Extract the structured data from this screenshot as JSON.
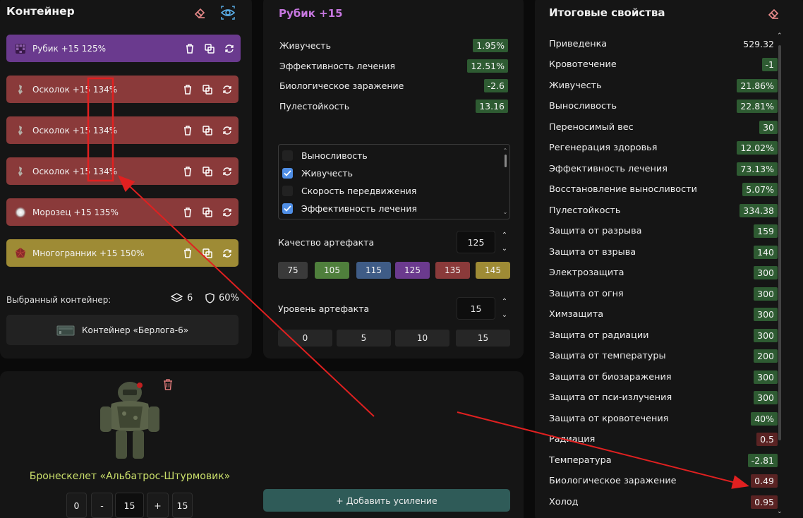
{
  "container_panel": {
    "title": "Контейнер",
    "items": [
      {
        "name": "Рубик +15 125%",
        "color": "#6a3a8e",
        "art": "rubik"
      },
      {
        "name": "Осколок +15 134%",
        "color": "#8a3a3a",
        "art": "shard"
      },
      {
        "name": "Осколок +15 134%",
        "color": "#8a3a3a",
        "art": "shard"
      },
      {
        "name": "Осколок +15 134%",
        "color": "#8a3a3a",
        "art": "shard"
      },
      {
        "name": "Морозец +15 135%",
        "color": "#8a3a3a",
        "art": "frost"
      },
      {
        "name": "Многогранник +15 150%",
        "color": "#9e8b35",
        "art": "polyhedron"
      }
    ],
    "selected_label": "Выбранный контейнер:",
    "slots_count": "6",
    "protection": "60%",
    "container_name": "Контейнер «Берлога-6»"
  },
  "artifact_panel": {
    "title": "Рубик +15",
    "stats": [
      {
        "label": "Живучесть",
        "value": "1.95%",
        "tone": "green"
      },
      {
        "label": "Эффективность лечения",
        "value": "12.51%",
        "tone": "green"
      },
      {
        "label": "Биологическое заражение",
        "value": "-2.6",
        "tone": "green"
      },
      {
        "label": "Пулестойкость",
        "value": "13.16",
        "tone": "green"
      }
    ],
    "filters": [
      {
        "label": "Выносливость",
        "checked": false
      },
      {
        "label": "Живучесть",
        "checked": true
      },
      {
        "label": "Скорость передвижения",
        "checked": false
      },
      {
        "label": "Эффективность лечения",
        "checked": true
      }
    ],
    "quality_label": "Качество артефакта",
    "quality_value": "125",
    "quality_options": [
      {
        "label": "75",
        "color": "#3a3a3a"
      },
      {
        "label": "105",
        "color": "#4f7f3c"
      },
      {
        "label": "115",
        "color": "#3f5c86"
      },
      {
        "label": "125",
        "color": "#6b3a8e"
      },
      {
        "label": "135",
        "color": "#8a3a3a"
      },
      {
        "label": "145",
        "color": "#9e8b35"
      }
    ],
    "level_label": "Уровень артефакта",
    "level_value": "15",
    "level_options": [
      "0",
      "5",
      "10",
      "15"
    ]
  },
  "result_panel": {
    "title": "Итоговые свойства",
    "rows": [
      {
        "label": "Приведенка",
        "value": "529.32",
        "tone": "plain"
      },
      {
        "label": "Кровотечение",
        "value": "-1",
        "tone": "green"
      },
      {
        "label": "Живучесть",
        "value": "21.86%",
        "tone": "green"
      },
      {
        "label": "Выносливость",
        "value": "22.81%",
        "tone": "green"
      },
      {
        "label": "Переносимый вес",
        "value": "30",
        "tone": "green"
      },
      {
        "label": "Регенерация здоровья",
        "value": "12.02%",
        "tone": "green"
      },
      {
        "label": "Эффективность лечения",
        "value": "73.13%",
        "tone": "green"
      },
      {
        "label": "Восстановление выносливости",
        "value": "5.07%",
        "tone": "green"
      },
      {
        "label": "Пулестойкость",
        "value": "334.38",
        "tone": "green"
      },
      {
        "label": "Защита от разрыва",
        "value": "159",
        "tone": "green"
      },
      {
        "label": "Защита от взрыва",
        "value": "140",
        "tone": "green"
      },
      {
        "label": "Электрозащита",
        "value": "300",
        "tone": "green"
      },
      {
        "label": "Защита от огня",
        "value": "300",
        "tone": "green"
      },
      {
        "label": "Химзащита",
        "value": "300",
        "tone": "green"
      },
      {
        "label": "Защита от радиации",
        "value": "300",
        "tone": "green"
      },
      {
        "label": "Защита от температуры",
        "value": "200",
        "tone": "green"
      },
      {
        "label": "Защита от биозаражения",
        "value": "300",
        "tone": "green"
      },
      {
        "label": "Защита от пси-излучения",
        "value": "300",
        "tone": "green"
      },
      {
        "label": "Защита от кровотечения",
        "value": "40%",
        "tone": "green"
      },
      {
        "label": "Радиация",
        "value": "0.5",
        "tone": "red"
      },
      {
        "label": "Температура",
        "value": "-2.81",
        "tone": "green"
      },
      {
        "label": "Биологическое заражение",
        "value": "0.49",
        "tone": "red"
      },
      {
        "label": "Холод",
        "value": "0.95",
        "tone": "red"
      }
    ]
  },
  "armor_panel": {
    "name": "Бронескелет «Альбатрос-Штурмовик»",
    "min": "0",
    "minus": "-",
    "level": "15",
    "plus": "+",
    "max": "15",
    "add_button": "+ Добавить усиление"
  },
  "annotations": {
    "color": "#e02020"
  }
}
